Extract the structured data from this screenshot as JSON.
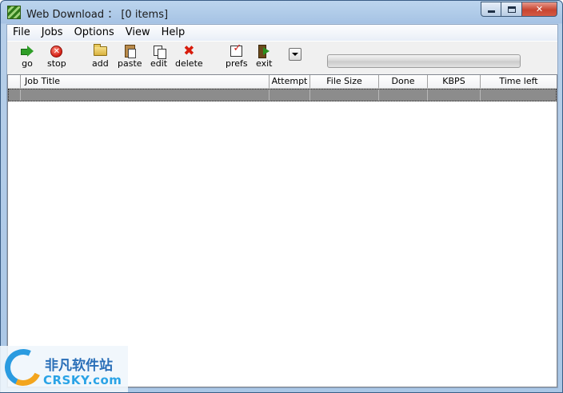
{
  "window": {
    "title": "Web Download ： [0 items]",
    "caption_buttons": {
      "minimize": "minimize",
      "maximize": "maximize",
      "close": "✕"
    }
  },
  "menu": [
    "File",
    "Jobs",
    "Options",
    "View",
    "Help"
  ],
  "toolbar": {
    "go": "go",
    "stop": "stop",
    "add": "add",
    "paste": "paste",
    "edit": "edit",
    "delete": "delete",
    "prefs": "prefs",
    "exit": "exit"
  },
  "progress": {
    "value": 0
  },
  "list": {
    "columns": [
      "",
      "Job Title",
      "Attempt",
      "File Size",
      "Done",
      "KBPS",
      "Time left"
    ],
    "rows": [
      [
        "",
        "",
        "",
        "",
        "",
        "",
        ""
      ]
    ]
  },
  "watermark": {
    "cn": "非凡软件站",
    "en": "CRSKY.com"
  },
  "colors": {
    "selected_row": "#8c8c8c",
    "title_bar": "#a6c3e4",
    "close_button": "#c84531"
  }
}
